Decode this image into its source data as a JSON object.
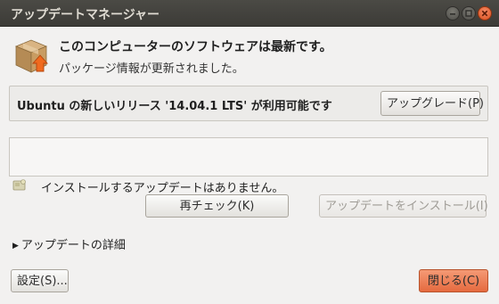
{
  "window": {
    "title": "アップデートマネージャー"
  },
  "header": {
    "title": "このコンピューターのソフトウェアは最新です。",
    "subtitle": "パッケージ情報が更新されました。"
  },
  "release": {
    "text": "Ubuntu の新しいリリース '14.04.1 LTS' が利用可能です",
    "upgrade_label": "アップグレード(P)"
  },
  "status": {
    "text": "インストールするアップデートはありません。"
  },
  "actions": {
    "recheck_label": "再チェック(K)",
    "install_label": "アップデートをインストール(I)"
  },
  "details": {
    "label": "アップデートの詳細"
  },
  "footer": {
    "settings_label": "設定(S)...",
    "close_label": "閉じる(C)"
  },
  "icons": {
    "titlebar": [
      "minimize-icon",
      "maximize-icon",
      "close-icon"
    ],
    "package": "package-box-icon",
    "status": "update-status-icon",
    "expander": "triangle-right-icon"
  },
  "colors": {
    "titlebar": "#3c3b37",
    "close_button": "#e56a3f",
    "window_bg": "#f2f1f0"
  }
}
